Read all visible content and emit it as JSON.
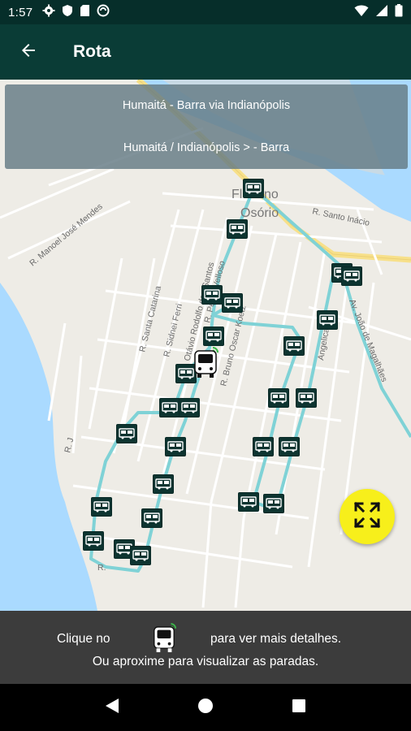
{
  "status_bar": {
    "time": "1:57",
    "icons": [
      "gear-icon",
      "shield-icon",
      "sd-card-icon",
      "cast-icon",
      "wifi-icon",
      "signal-icon",
      "battery-icon"
    ]
  },
  "app_bar": {
    "title": "Rota",
    "back_icon": "arrow-left-icon"
  },
  "route_panel": {
    "line1": "Humaitá - Barra via Indianópolis",
    "line2": "Humaitá / Indianópolis > - Barra"
  },
  "map": {
    "labels": {
      "place_name_1": "Floriano",
      "place_name_2": "Osório",
      "street_santo_inacio": "R. Santo Inácio",
      "street_manoel_jose_mendes": "R. Manoel José Mendes",
      "street_santa_catarina": "R. Santa Catarina",
      "street_sidnei_ferri": "R. Sidnei Ferri",
      "street_otavio_rodolfo": "R. Otávio Rodolfo dos Santos",
      "street_pedro_velloso": "R. Pedro Velloso",
      "street_bruno_oscar_koetz": "R. Bruno Oscar Koetz",
      "street_angelica": "Angelica De",
      "street_joao_magalhaes": "Av. João de Magalhães",
      "street_rj": "R. J",
      "street_bottom": "R."
    },
    "colors": {
      "route": "#7fd2d6",
      "stop": "#0d3430",
      "water": "#aadaff",
      "land": "#eeece6",
      "highway": "#f7e08a"
    },
    "fab_icon": "fullscreen-expand-icon"
  },
  "info_bar": {
    "text_before": "Clique no",
    "text_after": "para ver mais detalhes.",
    "text_line2": "Ou aproxime para visualizar as paradas.",
    "icon": "bus-icon"
  },
  "nav_bar": {
    "back_icon": "nav-back-icon",
    "home_icon": "nav-home-icon",
    "recents_icon": "nav-recents-icon"
  }
}
